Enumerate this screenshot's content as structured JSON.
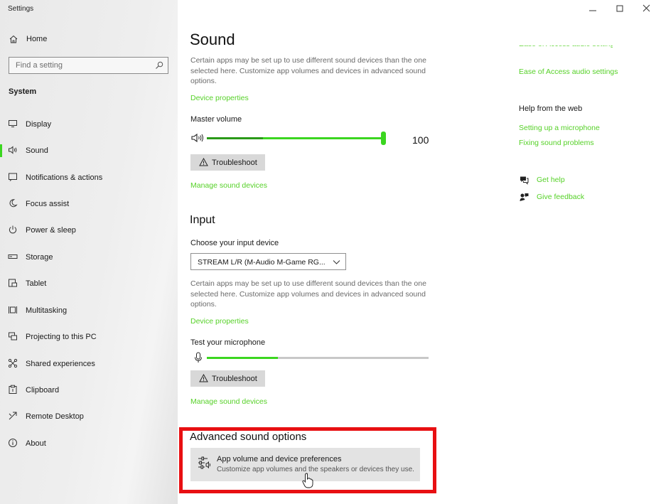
{
  "window": {
    "title": "Settings"
  },
  "sidebar": {
    "home_label": "Home",
    "search_placeholder": "Find a setting",
    "section_label": "System",
    "items": [
      {
        "label": "Display",
        "icon": "display-icon"
      },
      {
        "label": "Sound",
        "icon": "speaker-icon",
        "active": true
      },
      {
        "label": "Notifications & actions",
        "icon": "notifications-icon"
      },
      {
        "label": "Focus assist",
        "icon": "moon-icon"
      },
      {
        "label": "Power & sleep",
        "icon": "power-icon"
      },
      {
        "label": "Storage",
        "icon": "storage-icon"
      },
      {
        "label": "Tablet",
        "icon": "tablet-icon"
      },
      {
        "label": "Multitasking",
        "icon": "multitasking-icon"
      },
      {
        "label": "Projecting to this PC",
        "icon": "projecting-icon"
      },
      {
        "label": "Shared experiences",
        "icon": "shared-experiences-icon"
      },
      {
        "label": "Clipboard",
        "icon": "clipboard-icon"
      },
      {
        "label": "Remote Desktop",
        "icon": "remote-desktop-icon"
      },
      {
        "label": "About",
        "icon": "info-icon"
      }
    ]
  },
  "main": {
    "title": "Sound",
    "output": {
      "description": "Certain apps may be set up to use different sound devices than the one selected here. Customize app volumes and devices in advanced sound options.",
      "device_properties_link": "Device properties",
      "master_volume_label": "Master volume",
      "master_volume_value": "100",
      "master_volume_level": 1.0,
      "volume_meter_level": 0.32,
      "troubleshoot_label": "Troubleshoot",
      "manage_devices_link": "Manage sound devices"
    },
    "input": {
      "heading": "Input",
      "choose_label": "Choose your input device",
      "selected_device": "STREAM L/R (M-Audio M-Game RG...",
      "description": "Certain apps may be set up to use different sound devices than the one selected here. Customize app volumes and devices in advanced sound options.",
      "device_properties_link": "Device properties",
      "test_label": "Test your microphone",
      "mic_level": 0.32,
      "troubleshoot_label": "Troubleshoot",
      "manage_devices_link": "Manage sound devices"
    },
    "advanced": {
      "heading": "Advanced sound options",
      "card_title": "App volume and device preferences",
      "card_subtitle": "Customize app volumes and the speakers or devices they use."
    }
  },
  "related": {
    "ease_of_access_link": "Ease of Access audio settings",
    "help_heading": "Help from the web",
    "help_links": [
      "Setting up a microphone",
      "Fixing sound problems"
    ],
    "get_help_link": "Get help",
    "give_feedback_link": "Give feedback"
  },
  "colors": {
    "accent": "#3bd620",
    "link": "#56d128",
    "highlight_border": "#e80f12"
  }
}
